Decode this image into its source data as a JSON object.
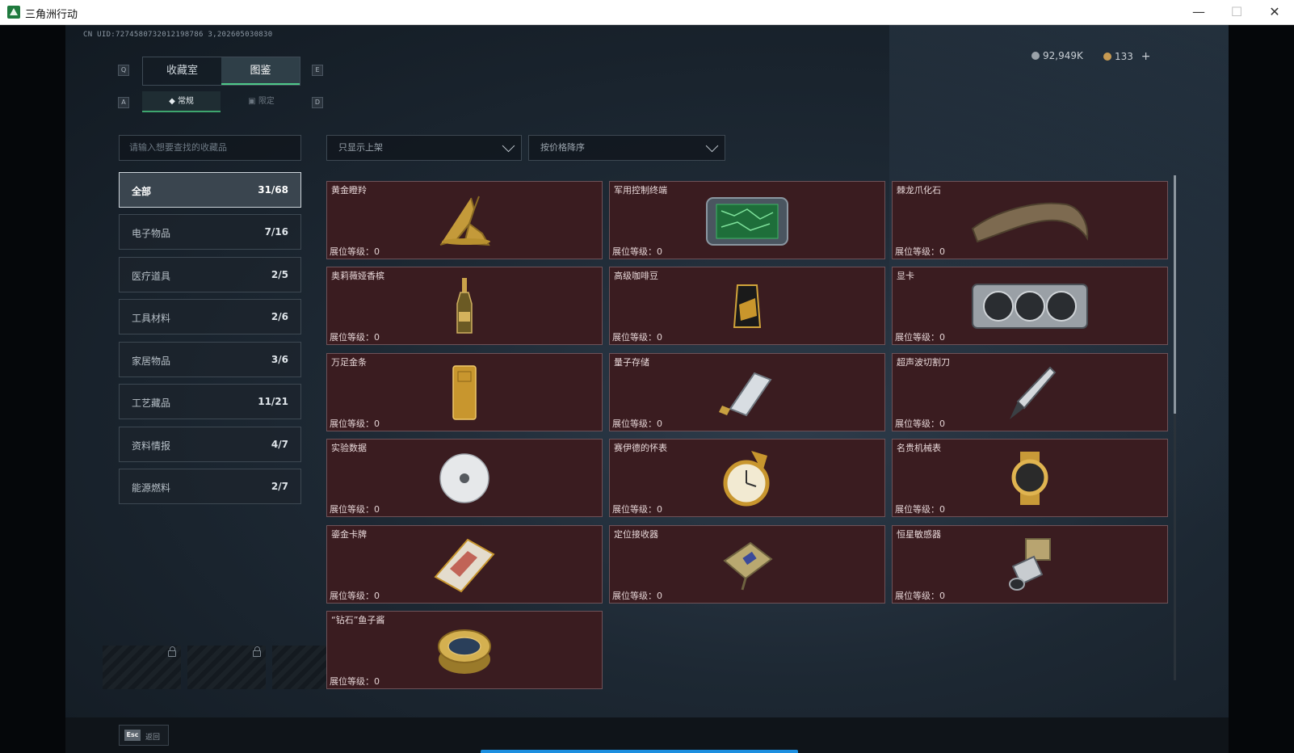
{
  "window": {
    "title": "三角洲行动",
    "minimize": "—",
    "maximize": "☐",
    "close": "✕"
  },
  "header": {
    "uid": "CN UID:7274580732012198786 3,202605030830",
    "currency_primary": "92,949K",
    "currency_secondary": "133",
    "add": "+"
  },
  "keys": {
    "q": "Q",
    "e": "E",
    "a": "A",
    "d": "D"
  },
  "tabs": [
    {
      "label": "收藏室"
    },
    {
      "label": "图鉴"
    }
  ],
  "subtabs": [
    {
      "label": "常规"
    },
    {
      "label": "限定"
    }
  ],
  "search": {
    "placeholder": "请输入想要查找的收藏品"
  },
  "filters": {
    "shelf": "只显示上架",
    "sort": "按价格降序"
  },
  "categories": [
    {
      "name": "全部",
      "count": "31/68"
    },
    {
      "name": "电子物品",
      "count": "7/16"
    },
    {
      "name": "医疗道具",
      "count": "2/5"
    },
    {
      "name": "工具材料",
      "count": "2/6"
    },
    {
      "name": "家居物品",
      "count": "3/6"
    },
    {
      "name": "工艺藏品",
      "count": "11/21"
    },
    {
      "name": "资料情报",
      "count": "4/7"
    },
    {
      "name": "能源燃料",
      "count": "2/7"
    }
  ],
  "items": [
    {
      "name": "黄金瞪羚",
      "level": "展位等级：0"
    },
    {
      "name": "军用控制终端",
      "level": "展位等级：0"
    },
    {
      "name": "棘龙爪化石",
      "level": "展位等级：0"
    },
    {
      "name": "奥莉薇娅香槟",
      "level": "展位等级：0"
    },
    {
      "name": "高级咖啡豆",
      "level": "展位等级：0"
    },
    {
      "name": "显卡",
      "level": "展位等级：0"
    },
    {
      "name": "万足金条",
      "level": "展位等级：0"
    },
    {
      "name": "量子存储",
      "level": "展位等级：0"
    },
    {
      "name": "超声波切割刀",
      "level": "展位等级：0"
    },
    {
      "name": "实验数据",
      "level": "展位等级：0"
    },
    {
      "name": "赛伊德的怀表",
      "level": "展位等级：0"
    },
    {
      "name": "名贵机械表",
      "level": "展位等级：0"
    },
    {
      "name": "鎏金卡牌",
      "level": "展位等级：0"
    },
    {
      "name": "定位接收器",
      "level": "展位等级：0"
    },
    {
      "name": "恒星敏感器",
      "level": "展位等级：0"
    },
    {
      "name": "“钻石”鱼子酱",
      "level": "展位等级：0"
    }
  ],
  "footer": {
    "esc_key": "Esc",
    "back": "返回"
  },
  "colors": {
    "accent": "#4fc98a",
    "card_bg": "#3a1c20",
    "progress": "#1c8fe0"
  }
}
